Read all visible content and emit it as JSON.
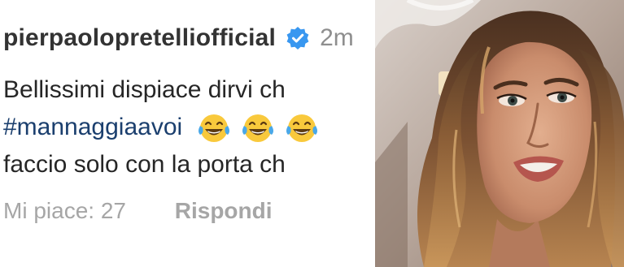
{
  "comment": {
    "username": "pierpaolopretelliofficial",
    "timestamp": "2m",
    "lines": [
      "Bellissimi dispiace dirvi ch",
      "#mannaggiaavoi",
      "faccio solo con la porta ch"
    ],
    "emoji_icons": [
      "laughing-tears-icon",
      "laughing-tears-icon",
      "laughing-tears-icon"
    ],
    "likes_label": "Mi piace: 27",
    "reply_label": "Rispondi"
  },
  "colors": {
    "hashtag": "#1b3f6e",
    "verified_badge": "#3897f0",
    "muted_text": "#a6a6a6"
  },
  "photo": {
    "subject": "selfie-portrait"
  }
}
